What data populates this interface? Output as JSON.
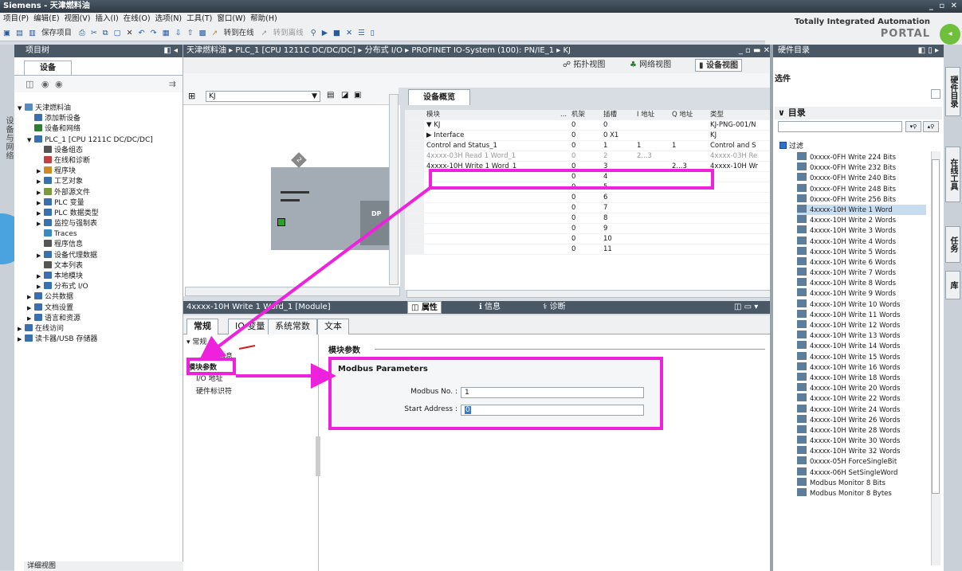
{
  "window": {
    "title": "Siemens - 天津燃料油",
    "controls": "_ ▫ ✕"
  },
  "menu": [
    "项目(P)",
    "编辑(E)",
    "视图(V)",
    "插入(I)",
    "在线(O)",
    "选项(N)",
    "工具(T)",
    "窗口(W)",
    "帮助(H)"
  ],
  "toolbar": {
    "save": "保存项目",
    "go_online": "转到在线",
    "go_offline": "转到离线"
  },
  "tia": {
    "line1": "Totally Integrated Automation",
    "line2": "PORTAL"
  },
  "left_vtab": "设备与网络",
  "project_tree": {
    "title": "项目树",
    "tab": "设备",
    "items": [
      {
        "label": "天津燃料油",
        "indent": 0,
        "exp": "▼",
        "color": "#5a8ac0"
      },
      {
        "label": "添加新设备",
        "indent": 1,
        "exp": "",
        "color": "#3a6fb0"
      },
      {
        "label": "设备和网络",
        "indent": 1,
        "exp": "",
        "color": "#2e7d32"
      },
      {
        "label": "PLC_1 [CPU 1211C DC/DC/DC]",
        "indent": 1,
        "exp": "▼",
        "color": "#3a6fb0"
      },
      {
        "label": "设备组态",
        "indent": 2,
        "exp": "",
        "color": "#555"
      },
      {
        "label": "在线和诊断",
        "indent": 2,
        "exp": "",
        "color": "#c24040"
      },
      {
        "label": "程序块",
        "indent": 2,
        "exp": "▶",
        "color": "#d08a20"
      },
      {
        "label": "工艺对象",
        "indent": 2,
        "exp": "▶",
        "color": "#3a6fb0"
      },
      {
        "label": "外部源文件",
        "indent": 2,
        "exp": "▶",
        "color": "#7a9a40"
      },
      {
        "label": "PLC 变量",
        "indent": 2,
        "exp": "▶",
        "color": "#3a6fb0"
      },
      {
        "label": "PLC 数据类型",
        "indent": 2,
        "exp": "▶",
        "color": "#3a6fb0"
      },
      {
        "label": "监控与强制表",
        "indent": 2,
        "exp": "▶",
        "color": "#3a6fb0"
      },
      {
        "label": "Traces",
        "indent": 2,
        "exp": "",
        "color": "#3a8ac0"
      },
      {
        "label": "程序信息",
        "indent": 2,
        "exp": "",
        "color": "#555"
      },
      {
        "label": "设备代理数据",
        "indent": 2,
        "exp": "▶",
        "color": "#3a6fb0"
      },
      {
        "label": "文本列表",
        "indent": 2,
        "exp": "",
        "color": "#555"
      },
      {
        "label": "本地模块",
        "indent": 2,
        "exp": "▶",
        "color": "#3a6fb0"
      },
      {
        "label": "分布式 I/O",
        "indent": 2,
        "exp": "▶",
        "color": "#3a6fb0"
      },
      {
        "label": "公共数据",
        "indent": 1,
        "exp": "▶",
        "color": "#3a6fb0"
      },
      {
        "label": "文档设置",
        "indent": 1,
        "exp": "▶",
        "color": "#3a6fb0"
      },
      {
        "label": "语言和资源",
        "indent": 1,
        "exp": "▶",
        "color": "#3a6fb0"
      },
      {
        "label": "在线访问",
        "indent": 0,
        "exp": "▶",
        "color": "#3a6fb0"
      },
      {
        "label": "读卡器/USB 存储器",
        "indent": 0,
        "exp": "▶",
        "color": "#3a6fb0"
      }
    ],
    "detail": "详细视图"
  },
  "breadcrumb": "天津燃料油 ▸ PLC_1 [CPU 1211C DC/DC/DC] ▸ 分布式 I/O ▸ PROFINET IO-System (100): PN/IE_1 ▸ KJ",
  "view_tabs": {
    "topology": "拓扑视图",
    "network": "网络视图",
    "device": "设备视图"
  },
  "device_select": "KJ",
  "rack_label": "DP",
  "rack_tag": "2",
  "overview": {
    "tab": "设备概览",
    "headers": [
      "",
      "模块",
      "...",
      "机架",
      "插槽",
      "I 地址",
      "Q 地址",
      "类型"
    ],
    "rows": [
      [
        "",
        "▼ KJ",
        "",
        "0",
        "0",
        "",
        "",
        "KJ-PNG-001/N"
      ],
      [
        "",
        "    ▶ Interface",
        "",
        "0",
        "0 X1",
        "",
        "",
        "KJ"
      ],
      [
        "",
        "Control and Status_1",
        "",
        "0",
        "1",
        "1",
        "1",
        "Control and S"
      ],
      [
        "",
        "4xxxx-03H Read 1 Word_1",
        "",
        "0",
        "2",
        "2...3",
        "",
        "4xxxx-03H Re"
      ],
      [
        "",
        "4xxxx-10H Write 1 Word_1",
        "",
        "0",
        "3",
        "",
        "2...3",
        "4xxxx-10H Wr"
      ],
      [
        "",
        "",
        "",
        "0",
        "4",
        "",
        "",
        ""
      ],
      [
        "",
        "",
        "",
        "0",
        "5",
        "",
        "",
        ""
      ],
      [
        "",
        "",
        "",
        "0",
        "6",
        "",
        "",
        ""
      ],
      [
        "",
        "",
        "",
        "0",
        "7",
        "",
        "",
        ""
      ],
      [
        "",
        "",
        "",
        "0",
        "8",
        "",
        "",
        ""
      ],
      [
        "",
        "",
        "",
        "0",
        "9",
        "",
        "",
        ""
      ],
      [
        "",
        "",
        "",
        "0",
        "10",
        "",
        "",
        ""
      ],
      [
        "",
        "",
        "",
        "0",
        "11",
        "",
        "",
        ""
      ]
    ]
  },
  "props": {
    "title": "4xxxx-10H Write 1 Word_1 [Module]",
    "tabs_right": {
      "props": "属性",
      "info": "信息",
      "diag": "诊断"
    },
    "tabs": [
      "常规",
      "IO 变量",
      "系统常数",
      "文本"
    ],
    "nav": [
      "▾ 常规",
      "目录信息",
      "模块参数",
      "I/O 地址",
      "硬件标识符"
    ],
    "section": "模块参数",
    "group": "Modbus Parameters",
    "fields": [
      {
        "label": "Modbus No. :",
        "value": "1"
      },
      {
        "label": "Start Address :",
        "value": "0"
      }
    ]
  },
  "hw_catalog": {
    "title": "硬件目录",
    "options": "选件",
    "catalog": "目录",
    "filter": "过滤",
    "items": [
      "0xxxx-0FH Write 224 Bits",
      "0xxxx-0FH Write 232 Bits",
      "0xxxx-0FH Write 240 Bits",
      "0xxxx-0FH Write 248 Bits",
      "0xxxx-0FH Write 256 Bits",
      "4xxxx-10H Write 1 Word",
      "4xxxx-10H Write 2 Words",
      "4xxxx-10H Write 3 Words",
      "4xxxx-10H Write 4 Words",
      "4xxxx-10H Write 5 Words",
      "4xxxx-10H Write 6 Words",
      "4xxxx-10H Write 7 Words",
      "4xxxx-10H Write 8 Words",
      "4xxxx-10H Write 9 Words",
      "4xxxx-10H Write 10 Words",
      "4xxxx-10H Write 11 Words",
      "4xxxx-10H Write 12 Words",
      "4xxxx-10H Write 13 Words",
      "4xxxx-10H Write 14 Words",
      "4xxxx-10H Write 15 Words",
      "4xxxx-10H Write 16 Words",
      "4xxxx-10H Write 18 Words",
      "4xxxx-10H Write 20 Words",
      "4xxxx-10H Write 22 Words",
      "4xxxx-10H Write 24 Words",
      "4xxxx-10H Write 26 Words",
      "4xxxx-10H Write 28 Words",
      "4xxxx-10H Write 30 Words",
      "4xxxx-10H Write 32 Words",
      "0xxxx-05H ForceSingleBit",
      "4xxxx-06H SetSingleWord",
      "Modbus Monitor 8 Bits",
      "Modbus Monitor 8 Bytes"
    ],
    "selected_index": 5
  },
  "right_vtabs": [
    "硬件目录",
    "在线工具",
    "任务",
    "库"
  ],
  "colors": {
    "highlight": "#ee22dd",
    "accent_blue": "#4aa3df",
    "header_dark": "#4a5866"
  }
}
